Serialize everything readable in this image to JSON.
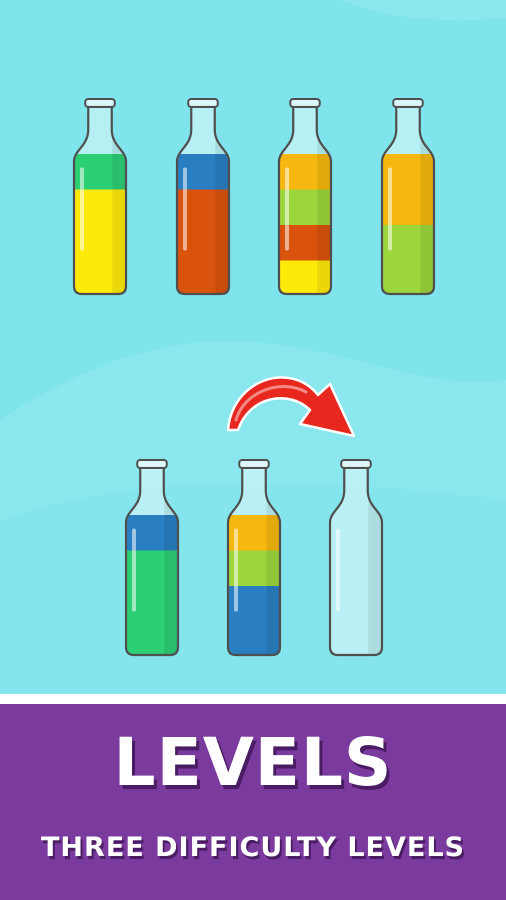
{
  "screen": {
    "background_color": "#7fe4ec",
    "banner_color": "#7b3a9d"
  },
  "top_row": [
    {
      "name": "bottle-1",
      "layers": [
        {
          "color": "#2dcf75",
          "level": 0.25
        },
        {
          "color": "#fdea0b",
          "level": 0.75
        }
      ]
    },
    {
      "name": "bottle-2",
      "layers": [
        {
          "color": "#2a7fc3",
          "level": 0.25
        },
        {
          "color": "#d9530c",
          "level": 0.75
        }
      ]
    },
    {
      "name": "bottle-3",
      "layers": [
        {
          "color": "#f6b80e",
          "level": 0.25
        },
        {
          "color": "#9dd63c",
          "level": 0.25
        },
        {
          "color": "#d9530c",
          "level": 0.25
        },
        {
          "color": "#fdea0b",
          "level": 0.25
        }
      ]
    },
    {
      "name": "bottle-4",
      "layers": [
        {
          "color": "#f6b80e",
          "level": 0.5
        },
        {
          "color": "#9dd63c",
          "level": 0.5
        }
      ]
    }
  ],
  "bottom_row": [
    {
      "name": "bottle-5",
      "layers": [
        {
          "color": "#2a7fc3",
          "level": 0.25
        },
        {
          "color": "#2dcf75",
          "level": 0.75
        }
      ]
    },
    {
      "name": "bottle-6",
      "layers": [
        {
          "color": "#f6b80e",
          "level": 0.25
        },
        {
          "color": "#9dd63c",
          "level": 0.25
        },
        {
          "color": "#2a7fc3",
          "level": 0.5
        }
      ]
    },
    {
      "name": "bottle-7",
      "layers": []
    }
  ],
  "pour_arrow": {
    "color": "#e8281e",
    "from": "bottle-6",
    "to": "bottle-7"
  },
  "banner": {
    "title": "LEVELS",
    "subtitle": "THREE DIFFICULTY LEVELS"
  }
}
